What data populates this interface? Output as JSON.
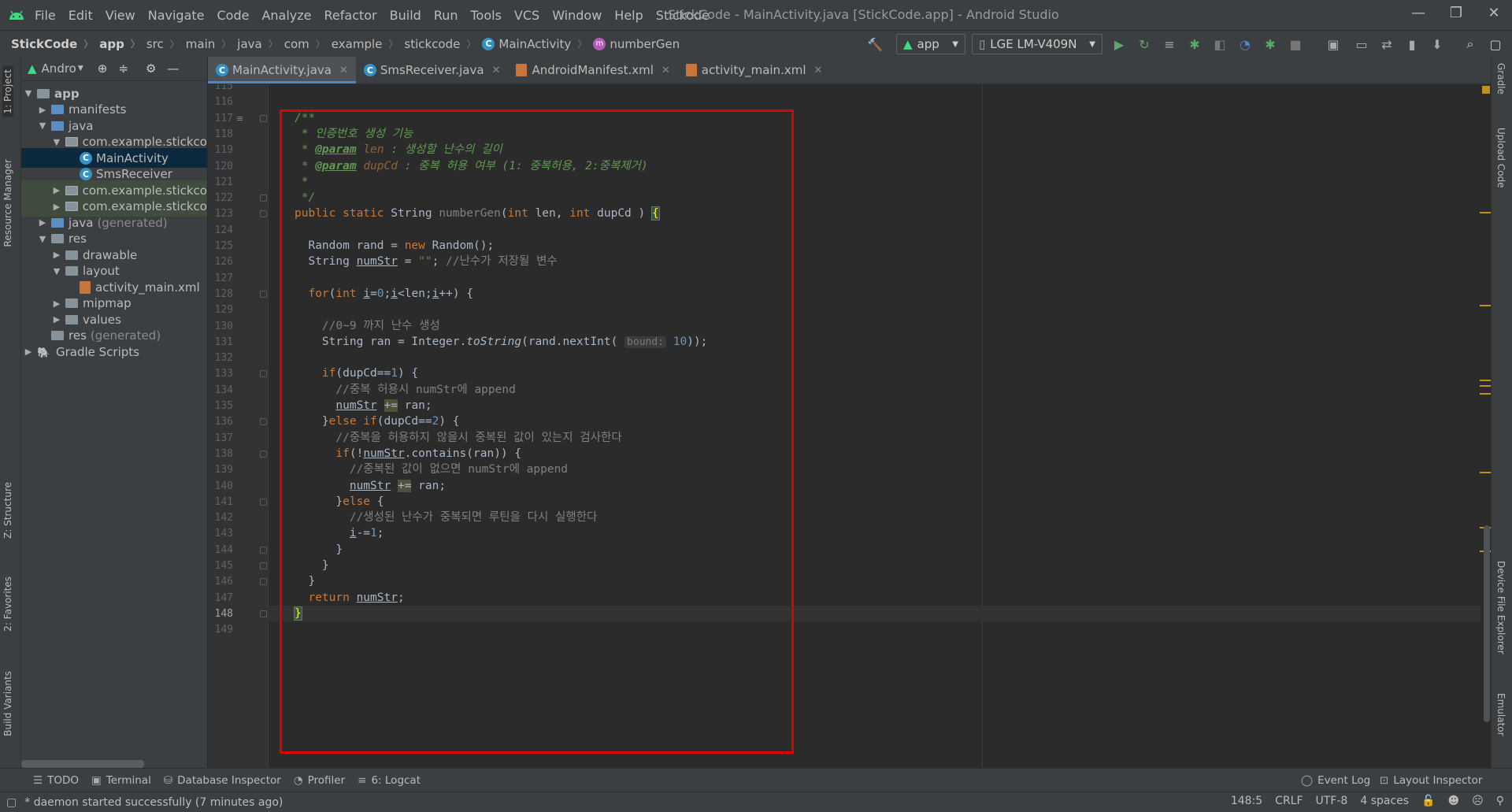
{
  "window": {
    "title": "StickCode - MainActivity.java [StickCode.app] - Android Studio",
    "menu": [
      "File",
      "Edit",
      "View",
      "Navigate",
      "Code",
      "Analyze",
      "Refactor",
      "Build",
      "Run",
      "Tools",
      "VCS",
      "Window",
      "Help",
      "Stickode"
    ],
    "controls": [
      "—",
      "❐",
      "✕"
    ]
  },
  "breadcrumb": [
    "StickCode",
    "app",
    "src",
    "main",
    "java",
    "com",
    "example",
    "stickcode",
    "MainActivity",
    "numberGen"
  ],
  "run_config": "app",
  "device": "LGE LM-V409N",
  "project_panel": {
    "view_selector": "Andro",
    "tree": [
      {
        "label": "app",
        "indent": 0,
        "arrow": "▼",
        "icon": "module"
      },
      {
        "label": "manifests",
        "indent": 1,
        "arrow": "▶",
        "icon": "folder"
      },
      {
        "label": "java",
        "indent": 1,
        "arrow": "▼",
        "icon": "folder"
      },
      {
        "label": "com.example.stickco",
        "indent": 2,
        "arrow": "▼",
        "icon": "package"
      },
      {
        "label": "MainActivity",
        "indent": 3,
        "arrow": "",
        "icon": "class",
        "selected": true
      },
      {
        "label": "SmsReceiver",
        "indent": 3,
        "arrow": "",
        "icon": "class"
      },
      {
        "label": "com.example.stickco",
        "indent": 2,
        "arrow": "▶",
        "icon": "package",
        "green": true
      },
      {
        "label": "com.example.stickco",
        "indent": 2,
        "arrow": "▶",
        "icon": "package",
        "green": true
      },
      {
        "label": "java",
        "suffix": "(generated)",
        "indent": 1,
        "arrow": "▶",
        "icon": "folder"
      },
      {
        "label": "res",
        "indent": 1,
        "arrow": "▼",
        "icon": "folder"
      },
      {
        "label": "drawable",
        "indent": 2,
        "arrow": "▶",
        "icon": "folder"
      },
      {
        "label": "layout",
        "indent": 2,
        "arrow": "▼",
        "icon": "folder"
      },
      {
        "label": "activity_main.xml",
        "indent": 3,
        "arrow": "",
        "icon": "xml"
      },
      {
        "label": "mipmap",
        "indent": 2,
        "arrow": "▶",
        "icon": "folder"
      },
      {
        "label": "values",
        "indent": 2,
        "arrow": "▶",
        "icon": "folder"
      },
      {
        "label": "res",
        "suffix": "(generated)",
        "indent": 1,
        "arrow": "",
        "icon": "folder"
      },
      {
        "label": "Gradle Scripts",
        "indent": 0,
        "arrow": "▶",
        "icon": "gradle"
      }
    ]
  },
  "tabs": [
    {
      "label": "MainActivity.java",
      "icon": "class",
      "active": true
    },
    {
      "label": "SmsReceiver.java",
      "icon": "class"
    },
    {
      "label": "AndroidManifest.xml",
      "icon": "xml"
    },
    {
      "label": "activity_main.xml",
      "icon": "xml"
    }
  ],
  "editor": {
    "line_numbers": [
      "115",
      "116",
      "117",
      "118",
      "119",
      "120",
      "121",
      "122",
      "123",
      "124",
      "125",
      "126",
      "127",
      "128",
      "129",
      "130",
      "131",
      "132",
      "133",
      "134",
      "135",
      "136",
      "137",
      "138",
      "139",
      "140",
      "141",
      "142",
      "143",
      "144",
      "145",
      "146",
      "147",
      "148",
      "149"
    ],
    "current_line": "148",
    "lines": [
      [],
      [],
      [
        [
          "d",
          "/**"
        ]
      ],
      [
        [
          "d",
          " * 인증번호 생성 기능"
        ]
      ],
      [
        [
          "d",
          " * "
        ],
        [
          "dt",
          "@param"
        ],
        [
          "dp",
          " len"
        ],
        [
          "d",
          " : 생성할 난수의 길이"
        ]
      ],
      [
        [
          "d",
          " * "
        ],
        [
          "dt",
          "@param"
        ],
        [
          "dp",
          " dupCd"
        ],
        [
          "d",
          " : 중복 허용 여부 (1: 중복허용, 2:중복제거)"
        ]
      ],
      [
        [
          "d",
          " *"
        ]
      ],
      [
        [
          "d",
          " */"
        ]
      ],
      [
        [
          "k",
          "public static "
        ],
        [
          "p",
          "String "
        ],
        [
          "unused",
          "numberGen"
        ],
        [
          "p",
          "("
        ],
        [
          "k",
          "int "
        ],
        [
          "p",
          "len, "
        ],
        [
          "k",
          "int "
        ],
        [
          "p",
          "dupCd ) "
        ],
        [
          "brace",
          "{"
        ]
      ],
      [],
      [
        [
          "p",
          "  Random rand = "
        ],
        [
          "k",
          "new "
        ],
        [
          "p",
          "Random();"
        ]
      ],
      [
        [
          "p",
          "  String "
        ],
        [
          "u",
          "numStr"
        ],
        [
          "p",
          " = "
        ],
        [
          "s",
          "\"\""
        ],
        [
          "p",
          "; "
        ],
        [
          "c",
          "//난수가 저장될 변수"
        ]
      ],
      [],
      [
        [
          "p",
          "  "
        ],
        [
          "k",
          "for"
        ],
        [
          "p",
          "("
        ],
        [
          "k",
          "int "
        ],
        [
          "u",
          "i"
        ],
        [
          "p",
          "="
        ],
        [
          "n",
          "0"
        ],
        [
          "p",
          ";"
        ],
        [
          "u",
          "i"
        ],
        [
          "p",
          "<len;"
        ],
        [
          "u",
          "i"
        ],
        [
          "p",
          "++) {"
        ]
      ],
      [],
      [
        [
          "c",
          "    //0~9 까지 난수 생성"
        ]
      ],
      [
        [
          "p",
          "    String ran = Integer."
        ],
        [
          "m",
          "toString"
        ],
        [
          "p",
          "(rand.nextInt( "
        ],
        [
          "hint",
          "bound:"
        ],
        [
          "p",
          " "
        ],
        [
          "n",
          "10"
        ],
        [
          "p",
          "));"
        ]
      ],
      [],
      [
        [
          "p",
          "    "
        ],
        [
          "k",
          "if"
        ],
        [
          "p",
          "(dupCd=="
        ],
        [
          "n",
          "1"
        ],
        [
          "p",
          ") {"
        ]
      ],
      [
        [
          "c",
          "      //중복 허용시 numStr에 append"
        ]
      ],
      [
        [
          "p",
          "      "
        ],
        [
          "u",
          "numStr"
        ],
        [
          "p",
          " "
        ],
        [
          "assign",
          "+="
        ],
        [
          "p",
          " ran;"
        ]
      ],
      [
        [
          "p",
          "    }"
        ],
        [
          "k",
          "else if"
        ],
        [
          "p",
          "(dupCd=="
        ],
        [
          "n",
          "2"
        ],
        [
          "p",
          ") {"
        ]
      ],
      [
        [
          "c",
          "      //중복을 허용하지 않을시 중복된 값이 있는지 검사한다"
        ]
      ],
      [
        [
          "p",
          "      "
        ],
        [
          "k",
          "if"
        ],
        [
          "p",
          "(!"
        ],
        [
          "u",
          "numStr"
        ],
        [
          "p",
          ".contains(ran)) {"
        ]
      ],
      [
        [
          "c",
          "        //중복된 값이 없으면 numStr에 append"
        ]
      ],
      [
        [
          "p",
          "        "
        ],
        [
          "u",
          "numStr"
        ],
        [
          "p",
          " "
        ],
        [
          "assign",
          "+="
        ],
        [
          "p",
          " ran;"
        ]
      ],
      [
        [
          "p",
          "      }"
        ],
        [
          "k",
          "else "
        ],
        [
          "p",
          "{"
        ]
      ],
      [
        [
          "c",
          "        //생성된 난수가 중복되면 루틴을 다시 실행한다"
        ]
      ],
      [
        [
          "p",
          "        "
        ],
        [
          "u",
          "i"
        ],
        [
          "p",
          "-="
        ],
        [
          "n",
          "1"
        ],
        [
          "p",
          ";"
        ]
      ],
      [
        [
          "p",
          "      }"
        ]
      ],
      [
        [
          "p",
          "    }"
        ]
      ],
      [
        [
          "p",
          "  }"
        ]
      ],
      [
        [
          "p",
          "  "
        ],
        [
          "k",
          "return "
        ],
        [
          "u",
          "numStr"
        ],
        [
          "p",
          ";"
        ]
      ],
      [
        [
          "brace",
          "}"
        ]
      ],
      []
    ]
  },
  "left_tools": [
    "1: Project",
    "Resource Manager",
    "Z: Structure",
    "2: Favorites",
    "Build Variants"
  ],
  "right_tools": [
    "Gradle",
    "Upload Code",
    "Device File Explorer",
    "Emulator"
  ],
  "bottom_tools": [
    "TODO",
    "Terminal",
    "Database Inspector",
    "Profiler",
    "6: Logcat"
  ],
  "bottom_tools_right": [
    "Event Log",
    "Layout Inspector"
  ],
  "status": {
    "message": "daemon started successfully (7 minutes ago)",
    "position": "148:5",
    "line_sep": "CRLF",
    "encoding": "UTF-8",
    "indent": "4 spaces"
  },
  "colors": {
    "accent": "#4a88c7",
    "highlight_box": "#e00000",
    "keyword": "#cc7832",
    "doc": "#629755"
  }
}
